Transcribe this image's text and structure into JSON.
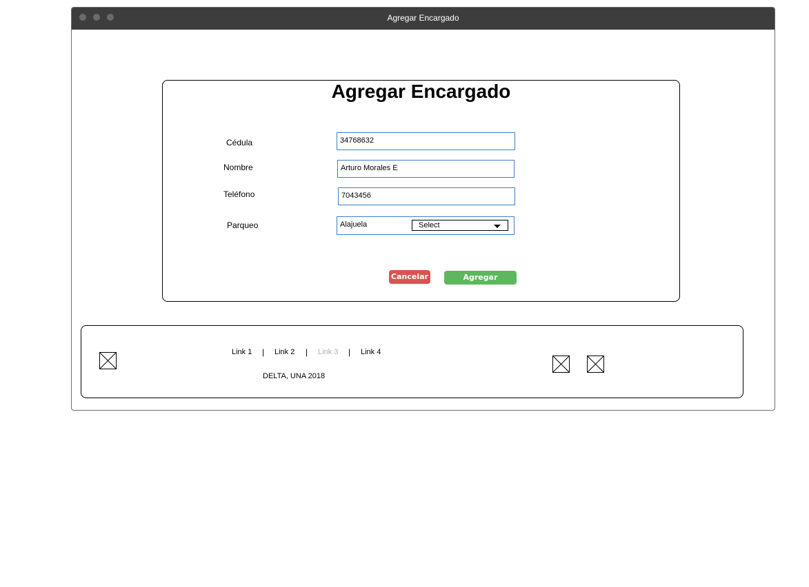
{
  "window": {
    "title": "Agregar Encargado"
  },
  "form": {
    "heading": "Agregar Encargado",
    "cedula_label": "Cédula",
    "cedula_value": "34768632",
    "nombre_label": "Nombre",
    "nombre_value": "Arturo Morales E",
    "telefono_label": "Teléfono",
    "telefono_value": "7043456",
    "parqueo_label": "Parqueo",
    "parqueo_value": "Alajuela",
    "parqueo_select": "Select",
    "cancel_label": "Cancelar",
    "submit_label": "Agregar"
  },
  "footer": {
    "links": [
      "Link 1",
      "Link 2",
      "Link 3",
      "Link 4"
    ],
    "separator": "|",
    "copyright": "DELTA, UNA 2018"
  },
  "colors": {
    "titlebar": "#3d3d3d",
    "field_border": "#3b7fc4",
    "cancel": "#d9534f",
    "submit": "#5cb85c",
    "link_disabled": "#b0b0b0"
  }
}
